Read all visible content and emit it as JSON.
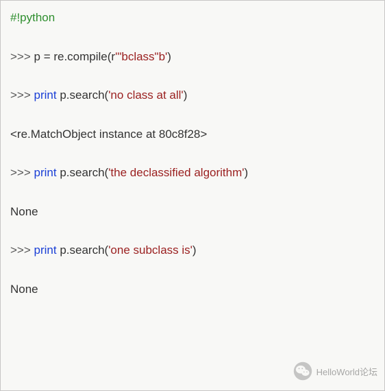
{
  "code": {
    "shebang": "#!python",
    "line1": {
      "prompt": ">>> ",
      "before_str": "p = re.compile(r",
      "str": "'\"bclass\"b'",
      "after_str": ")"
    },
    "line2": {
      "prompt": ">>> ",
      "kw": "print",
      "mid": " p.search(",
      "str": "'no class at all'",
      "after": ")"
    },
    "line3": "<re.MatchObject instance at 80c8f28>",
    "line4": {
      "prompt": ">>> ",
      "kw": "print",
      "mid": " p.search(",
      "str": "'the declassified algorithm'",
      "after": ")"
    },
    "line5": "None",
    "line6": {
      "prompt": ">>> ",
      "kw": "print",
      "mid": " p.search(",
      "str": "'one subclass is'",
      "after": ")"
    },
    "line7": "None"
  },
  "watermark": {
    "text": "HelloWorld论坛"
  }
}
